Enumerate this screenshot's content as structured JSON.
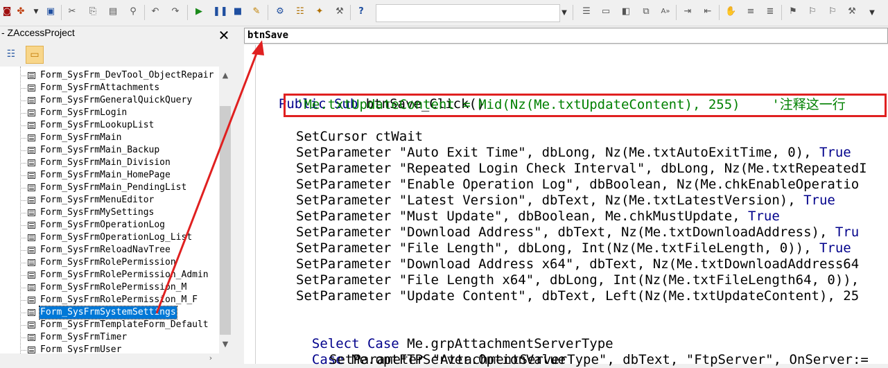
{
  "toolbar": {
    "icons": [
      "access-icon",
      "insert-icon",
      "save-icon",
      "cut-icon",
      "copy-icon",
      "paste-icon",
      "find-icon",
      "undo-icon",
      "redo-icon",
      "run-icon",
      "break-icon",
      "reset-icon",
      "design-mode-icon",
      "project-explorer-icon",
      "properties-icon",
      "object-browser-icon",
      "toolbox-icon",
      "help-icon",
      "indent-icon",
      "outdent-icon",
      "toggle-breakpoint-icon",
      "comment-block-icon",
      "uncomment-block-icon",
      "bookmark-icon",
      "next-bookmark-icon",
      "prev-bookmark-icon",
      "clear-bookmarks-icon"
    ],
    "combo_value": ""
  },
  "project": {
    "title": "- ZAccessProject",
    "close_glyph": "✕",
    "items": [
      "Form_SysFrm_DevTool_ObjectRepair",
      "Form_SysFrmAttachments",
      "Form_SysFrmGeneralQuickQuery",
      "Form_SysFrmLogin",
      "Form_SysFrmLookupList",
      "Form_SysFrmMain",
      "Form_SysFrmMain_Backup",
      "Form_SysFrmMain_Division",
      "Form_SysFrmMain_HomePage",
      "Form_SysFrmMain_PendingList",
      "Form_SysFrmMenuEditor",
      "Form_SysFrmMySettings",
      "Form_SysFrmOperationLog",
      "Form_SysFrmOperationLog_List",
      "Form_SysFrmReloadNavTree",
      "Form_SysFrmRolePermission",
      "Form_SysFrmRolePermission_Admin",
      "Form_SysFrmRolePermission_M",
      "Form_SysFrmRolePermission_M_F",
      "Form_SysFrmSystemSettings",
      "Form_SysFrmTemplateForm_Default",
      "Form_SysFrmTimer",
      "Form_SysFrmUser"
    ],
    "selected_index": 19
  },
  "code": {
    "object_combo": "btnSave",
    "sub_kw1": "Public",
    "sub_kw2": "Sub",
    "sub_name": " btnSave_Click()",
    "comment_line": "'Me.txtUpdateContent = Mid(Nz(Me.txtUpdateContent), 255)    '注释这一行",
    "set_cursor": "SetCursor ctWait",
    "params": [
      {
        "text": "SetParameter \"Auto Exit Time\", dbLong, Nz(Me.txtAutoExitTime, 0), ",
        "tail": "True"
      },
      {
        "text": "SetParameter \"Repeated Login Check Interval\", dbLong, Nz(Me.txtRepeatedI",
        "tail": ""
      },
      {
        "text": "SetParameter \"Enable Operation Log\", dbBoolean, Nz(Me.chkEnableOperatio",
        "tail": ""
      },
      {
        "text": "SetParameter \"Latest Version\", dbText, Nz(Me.txtLatestVersion), ",
        "tail": "True"
      },
      {
        "text": "SetParameter \"Must Update\", dbBoolean, Me.chkMustUpdate, ",
        "tail": "True"
      },
      {
        "text": "SetParameter \"Download Address\", dbText, Nz(Me.txtDownloadAddress), ",
        "tail": "Tru"
      },
      {
        "text": "SetParameter \"File Length\", dbLong, Int(Nz(Me.txtFileLength, 0)), ",
        "tail": "True"
      },
      {
        "text": "SetParameter \"Download Address x64\", dbText, Nz(Me.txtDownloadAddress64",
        "tail": ""
      },
      {
        "text": "SetParameter \"File Length x64\", dbLong, Int(Nz(Me.txtFileLength64, 0)),",
        "tail": ""
      },
      {
        "text": "SetParameter \"Update Content\", dbText, Left(Nz(Me.txtUpdateContent), 25",
        "tail": ""
      }
    ],
    "select_kw": "Select Case",
    "select_rest": " Me.grpAttachmentServerType",
    "case_kw": "Case",
    "case_rest": " Me.optFTPServer.OptionValue",
    "last_line": "SetParameter \"AttachmentServerType\", dbText, \"FtpServer\", OnServer:="
  },
  "colors": {
    "keyword": "#00008b",
    "comment": "#008000",
    "highlight_box": "#e02020",
    "arrow": "#e02020",
    "selection": "#0078d7"
  }
}
